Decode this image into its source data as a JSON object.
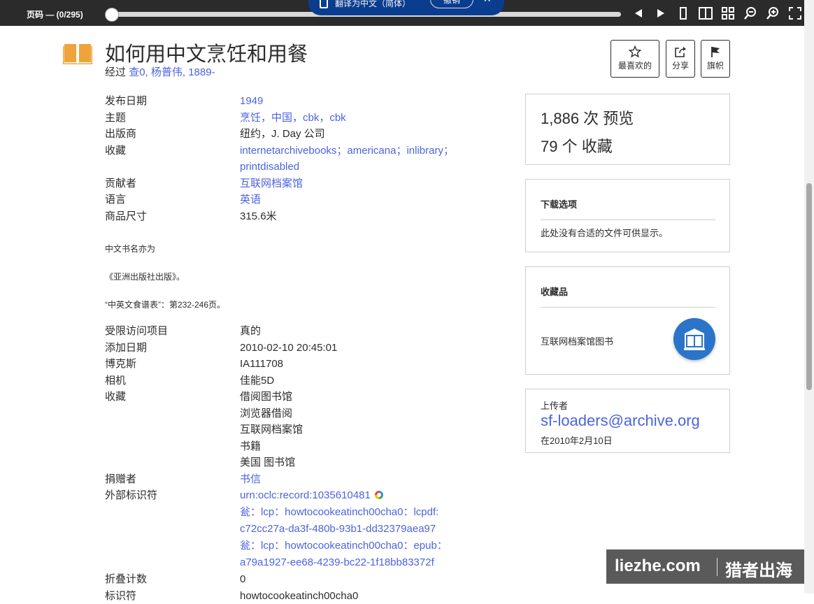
{
  "reader_bar": {
    "page_count": "页码 — (0/295)",
    "progress": 0,
    "icons": [
      "prev-page-icon",
      "next-page-icon",
      "one-page-view-icon",
      "two-page-view-icon",
      "thumbnail-view-icon",
      "zoom-out-icon",
      "zoom-in-icon",
      "fullscreen-icon"
    ]
  },
  "translate_bar": {
    "text": "翻译为中文（简体）",
    "undo_label": "撤销",
    "close_glyph": "✕"
  },
  "header": {
    "title": "如何用中文烹饪和用餐",
    "byline_prefix": "经过",
    "byline_link": "查0, 杨普伟, 1889-"
  },
  "actions": [
    {
      "label": "最喜欢的",
      "icon": "star-icon"
    },
    {
      "label": "分享",
      "icon": "share-icon"
    },
    {
      "label": "旗帜",
      "icon": "flag-icon"
    }
  ],
  "meta_top": [
    {
      "key": "发布日期",
      "value": "1949",
      "link": true
    },
    {
      "key": "主题",
      "value": "烹饪，中国，cbk，cbk",
      "link": true
    },
    {
      "key": "出版商",
      "value": "纽约，J. Day 公司",
      "link": false
    },
    {
      "key": "收藏",
      "value": "internetarchivebooks；americana；inlibrary；",
      "value2": "printdisabled",
      "link": true
    },
    {
      "key": "贡献者",
      "value": "互联网档案馆",
      "link": true
    },
    {
      "key": "语言",
      "value": "英语",
      "link": true
    },
    {
      "key": "商品尺寸",
      "value": "315.6米",
      "link": false
    }
  ],
  "notes": [
    "中文书名亦为",
    "《亚洲出版社出版》。",
    "“中英文食谱表”：第232-246页。"
  ],
  "meta_bottom": {
    "restricted": {
      "key": "受限访问项目",
      "value": "真的"
    },
    "added": {
      "key": "添加日期",
      "value": "2010-02-10 20:45:01"
    },
    "boxid": {
      "key": "博克斯",
      "value": "IA111708"
    },
    "camera": {
      "key": "相机",
      "value": "佳能5D"
    },
    "collection": {
      "key": "收藏",
      "values": [
        "借阅图书馆",
        "浏览器借阅",
        "互联网档案馆",
        "书籍",
        "美国 图书馆"
      ]
    },
    "donor": {
      "key": "捐赠者",
      "value": "书信"
    },
    "external": {
      "key": "外部标识符",
      "values": [
        "urn:oclc:record:1035610481",
        "瓮：lcp：howtocookeatinch00cha0：lcpdf:",
        "c72cc27a-da3f-480b-93b1-dd32379aea97",
        "瓮：lcp：howtocookeatinch00cha0：epub：",
        "a79a1927-ee68-4239-bc22-1f18bb83372f"
      ]
    },
    "foldout": {
      "key": "折叠计数",
      "value": "0"
    },
    "identifier": {
      "key": "标识符",
      "value": "howtocookeatinch00cha0"
    }
  },
  "stats": {
    "views": "1,886 次 预览",
    "favorites": "79 个 收藏"
  },
  "downloads": {
    "heading": "下载选项",
    "empty": "此处没有合适的文件可供显示。"
  },
  "collection_panel": {
    "heading": "收藏品",
    "item": "互联网档案馆图书"
  },
  "uploader": {
    "label": "上传者",
    "email": "sf-loaders@archive.org",
    "date": "在2010年2月10日"
  },
  "watermark": {
    "left": "liezhe.com",
    "right": "猎者出海"
  },
  "colors": {
    "link": "#4b64de",
    "topbar": "#2b2b2b",
    "translate_bar": "#0b3d8f",
    "book_icon": "#f0a33a",
    "collection_circle": "#2a75c9"
  }
}
